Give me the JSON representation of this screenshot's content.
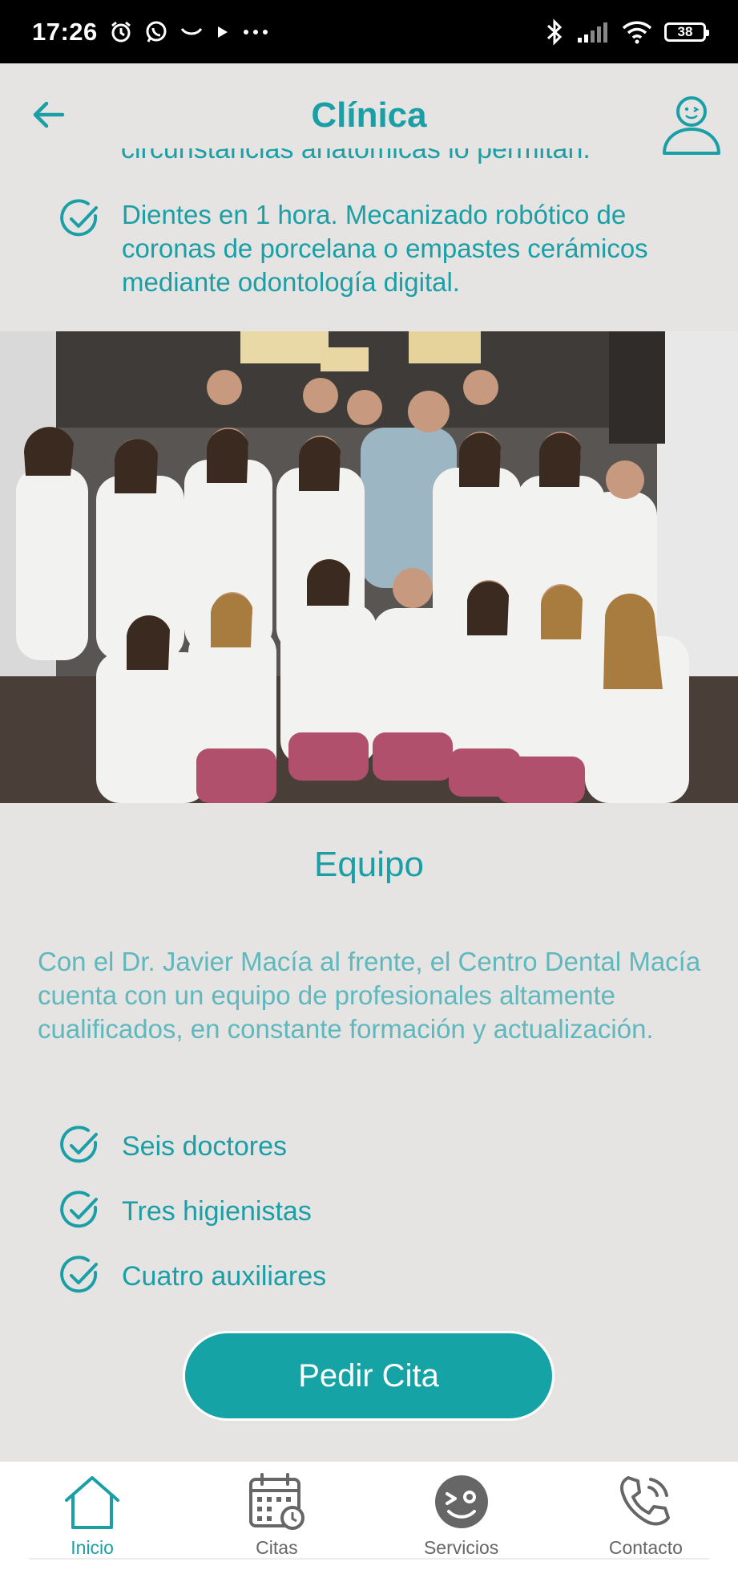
{
  "status_bar": {
    "time": "17:26",
    "battery": "38",
    "icons": [
      "alarm-icon",
      "whatsapp-icon",
      "smile-icon",
      "play-icon",
      "more-icon",
      "bluetooth-icon",
      "signal-icon",
      "wifi-icon",
      "battery-icon"
    ]
  },
  "header": {
    "title": "Clínica",
    "back_icon": "back-arrow-icon",
    "profile_icon": "user-icon"
  },
  "intro": {
    "cutoff_text": "circunstancias anatómicas lo permitan.",
    "feature_text": "Dientes en 1 hora. Mecanizado robótico de coronas de porcelana o empastes cerámicos mediante odontología digital."
  },
  "team": {
    "title": "Equipo",
    "description": "Con el Dr. Javier Macía al frente, el Centro Dental Macía cuenta con un equipo de profesionales altamente cualificados, en constante formación y actualización.",
    "items": [
      {
        "label": "Seis doctores"
      },
      {
        "label": "Tres higienistas"
      },
      {
        "label": "Cuatro auxiliares"
      }
    ],
    "cta_label": "Pedir Cita"
  },
  "nav": {
    "items": [
      {
        "label": "Inicio",
        "icon": "home-icon",
        "active": true
      },
      {
        "label": "Citas",
        "icon": "calendar-icon",
        "active": false
      },
      {
        "label": "Servicios",
        "icon": "services-icon",
        "active": false
      },
      {
        "label": "Contacto",
        "icon": "phone-icon",
        "active": false
      }
    ]
  },
  "colors": {
    "accent": "#1a9fa6",
    "background": "#e5e4e3",
    "cta": "#16a3a6"
  }
}
